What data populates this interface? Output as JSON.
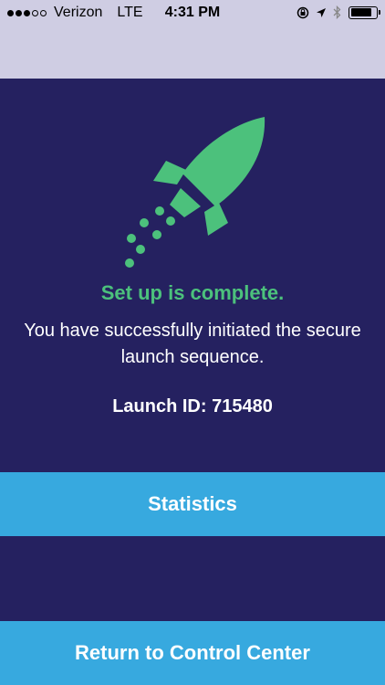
{
  "status_bar": {
    "signal_filled": 3,
    "signal_total": 5,
    "carrier": "Verizon",
    "network": "LTE",
    "time": "4:31 PM",
    "icons": [
      "rotation-lock-icon",
      "location-arrow-icon",
      "bluetooth-icon",
      "battery-icon"
    ],
    "battery_level": 0.85
  },
  "colors": {
    "background": "#252160",
    "header": "#cfcde3",
    "accent_green": "#4cc17c",
    "button_blue": "#37a9df"
  },
  "main": {
    "icon": "rocket-icon",
    "headline": "Set up is complete.",
    "message": "You have successfully initiated the secure launch sequence.",
    "launch_id": "Launch ID: 715480"
  },
  "buttons": {
    "statistics": "Statistics",
    "return": "Return to Control Center"
  }
}
